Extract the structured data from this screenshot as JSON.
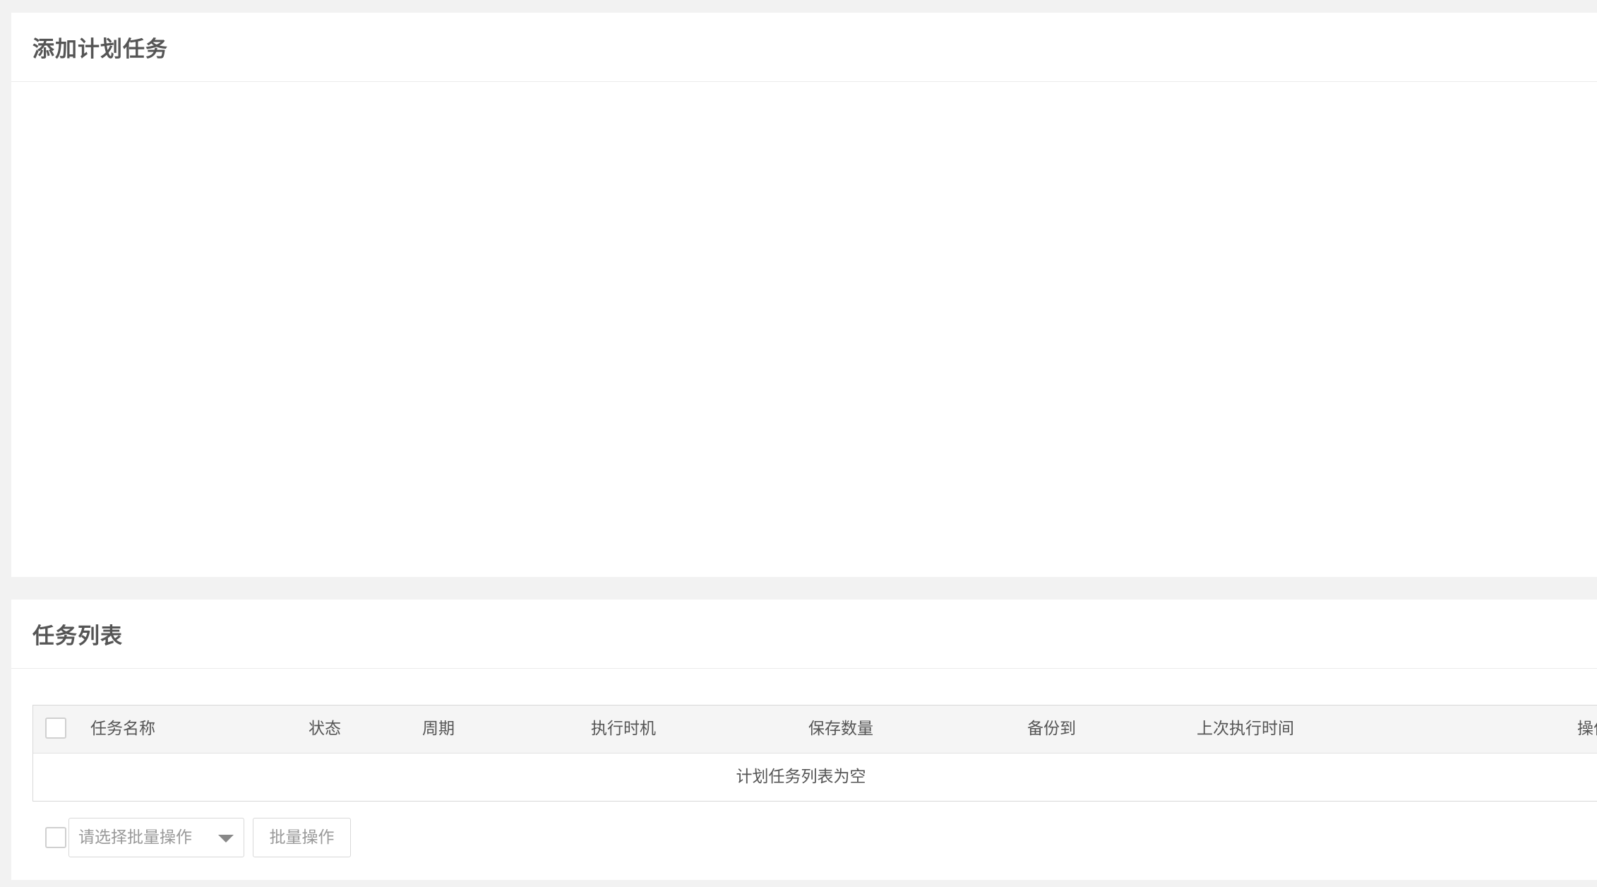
{
  "add_task": {
    "title": "添加计划任务"
  },
  "task_list": {
    "title": "任务列表",
    "columns": [
      "任务名称",
      "状态",
      "周期",
      "执行时机",
      "保存数量",
      "备份到",
      "上次执行时间",
      "操作"
    ],
    "empty_message": "计划任务列表为空",
    "rows": []
  },
  "batch": {
    "select_placeholder": "请选择批量操作",
    "button_label": "批量操作"
  }
}
